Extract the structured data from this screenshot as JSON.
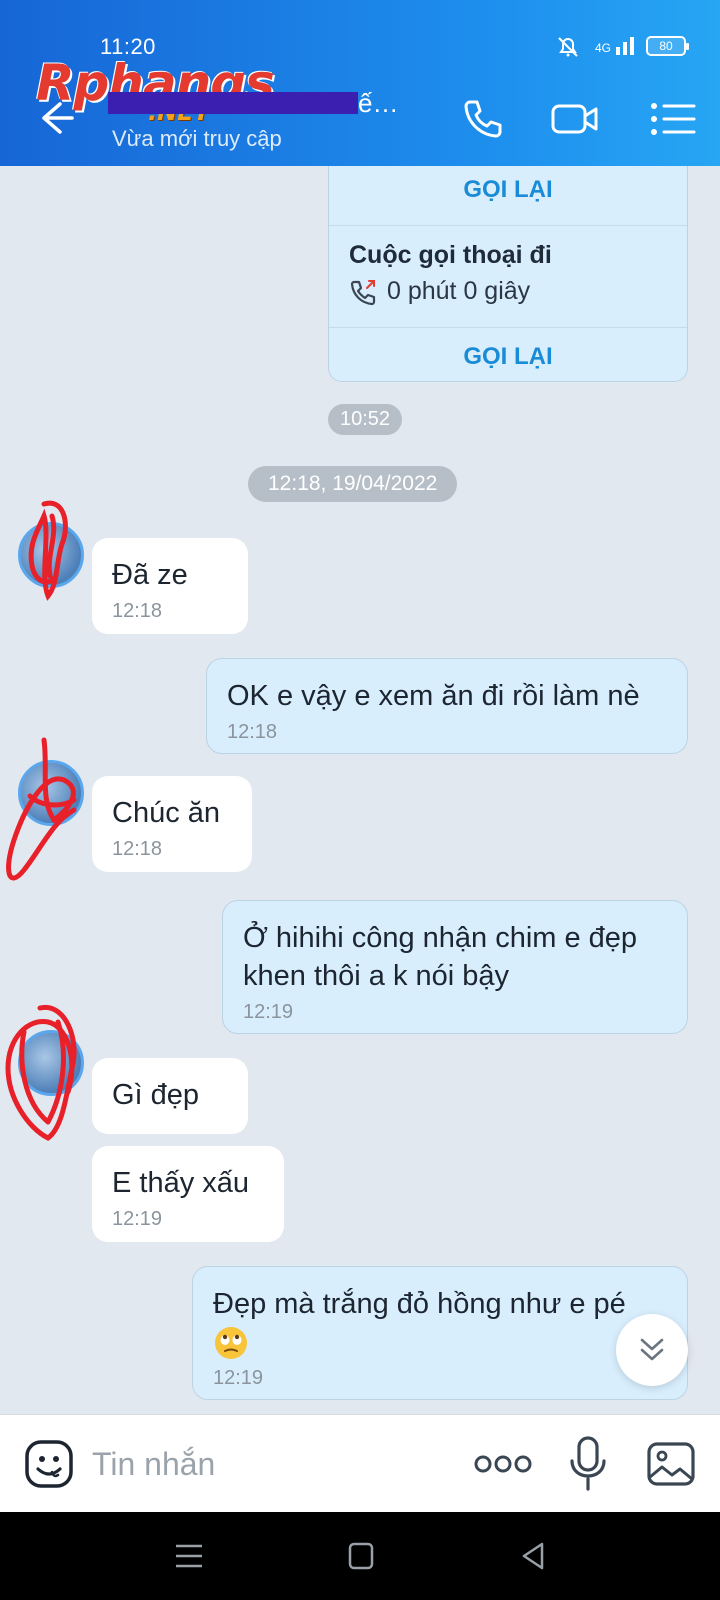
{
  "status_bar": {
    "time": "11:20",
    "network": "4G",
    "battery": "80"
  },
  "header": {
    "watermark_main": "Rphangs",
    "watermark_net": ".NET",
    "contact_name_suffix": "ế…",
    "contact_status": "Vừa mới truy cập"
  },
  "call_card": {
    "redial_label_top": "GỌI LẠI",
    "title": "Cuộc gọi thoại đi",
    "duration": "0 phút 0 giây",
    "redial_label": "GỌI LẠI"
  },
  "separators": {
    "call_time": "10:52",
    "date": "12:18, 19/04/2022"
  },
  "messages": [
    {
      "dir": "in",
      "text": "Đã ze",
      "time": "12:18"
    },
    {
      "dir": "out",
      "text": "OK e vậy e xem ăn đi rồi làm nè",
      "time": "12:18"
    },
    {
      "dir": "in",
      "text": "Chúc ăn",
      "time": "12:18"
    },
    {
      "dir": "out",
      "text": "Ở hihihi công nhận chim e đẹp khen thôi a k nói bậy",
      "time": "12:19"
    },
    {
      "dir": "in",
      "text": "Gì đẹp",
      "time": ""
    },
    {
      "dir": "in",
      "text": "E thấy xấu",
      "time": "12:19"
    },
    {
      "dir": "out",
      "text": "Đẹp mà trắng đỏ hồng như e pé",
      "time": "12:19"
    }
  ],
  "input": {
    "placeholder": "Tin nhắn"
  },
  "colors": {
    "header_start": "#1766d6",
    "header_end": "#27a6f4",
    "accent": "#1a8bd6",
    "out_bubble": "#d8eefd",
    "chat_bg": "#e2e8ef",
    "scribble": "#e8202a"
  },
  "icons": [
    "back-arrow-icon",
    "phone-icon",
    "video-camera-icon",
    "menu-list-icon",
    "missed-call-icon",
    "emoji-icon",
    "more-dots-icon",
    "microphone-icon",
    "gallery-icon",
    "chevron-double-down-icon"
  ]
}
